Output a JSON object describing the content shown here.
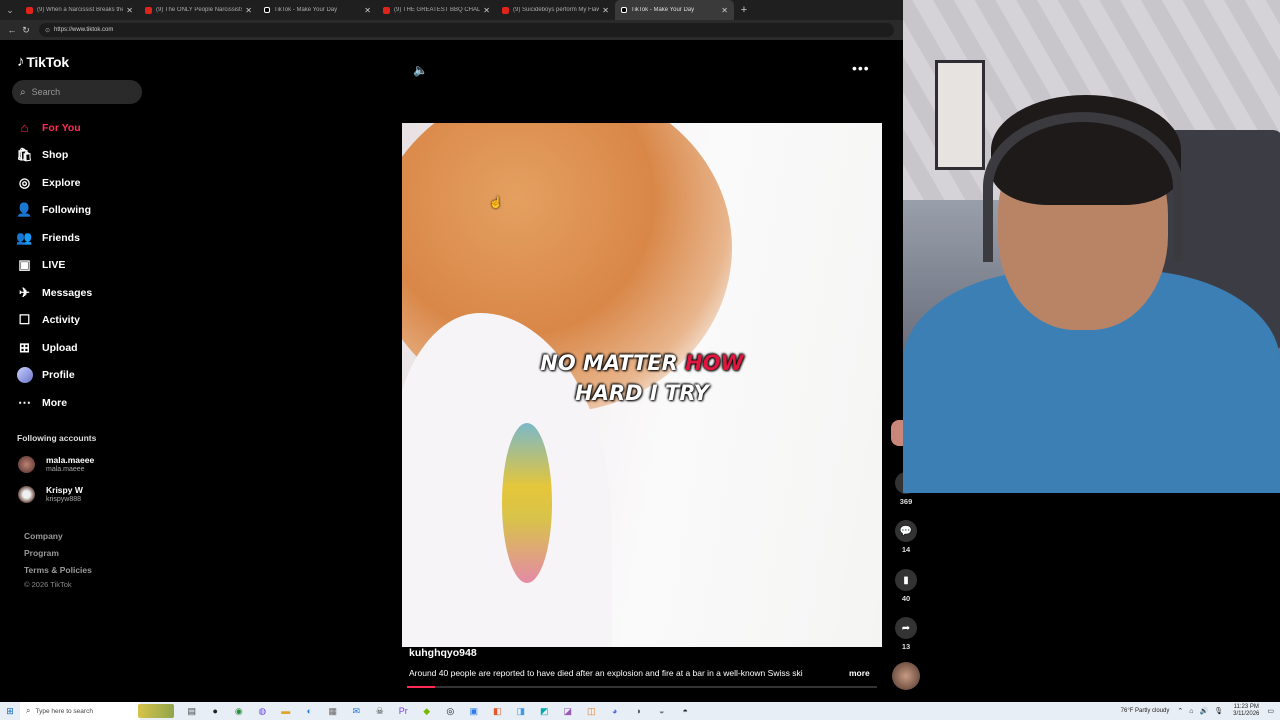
{
  "browser": {
    "tabs": [
      {
        "title": "(9) When a Narcissist Breaks the L",
        "type": "yt",
        "active": false
      },
      {
        "title": "(9) The ONLY People Narcissists H",
        "type": "yt",
        "active": false
      },
      {
        "title": "TikTok - Make Your Day",
        "type": "tt",
        "active": false
      },
      {
        "title": "(9) THE GREATEST BBQ CHALLENG",
        "type": "yt",
        "active": false
      },
      {
        "title": "(9) Suicideboys perform My Flaw",
        "type": "yt",
        "active": false
      },
      {
        "title": "TikTok - Make Your Day",
        "type": "tt",
        "active": true
      }
    ],
    "url": "https://www.tiktok.com"
  },
  "tiktok": {
    "logo": "TikTok",
    "search_placeholder": "Search",
    "nav": [
      {
        "label": "For You",
        "icon": "home-icon",
        "glyph": "⌂",
        "active": true
      },
      {
        "label": "Shop",
        "icon": "shopping-bag-icon",
        "glyph": "🛍",
        "active": false
      },
      {
        "label": "Explore",
        "icon": "compass-icon",
        "glyph": "◎",
        "active": false
      },
      {
        "label": "Following",
        "icon": "person-follow-icon",
        "glyph": "👤",
        "active": false
      },
      {
        "label": "Friends",
        "icon": "friends-icon",
        "glyph": "👥",
        "active": false
      },
      {
        "label": "LIVE",
        "icon": "live-icon",
        "glyph": "▣",
        "active": false
      },
      {
        "label": "Messages",
        "icon": "paper-plane-icon",
        "glyph": "✈",
        "active": false
      },
      {
        "label": "Activity",
        "icon": "activity-icon",
        "glyph": "☐",
        "active": false
      },
      {
        "label": "Upload",
        "icon": "upload-plus-icon",
        "glyph": "⊞",
        "active": false
      },
      {
        "label": "Profile",
        "icon": "profile-avatar-icon",
        "glyph": "",
        "active": false
      },
      {
        "label": "More",
        "icon": "more-dots-icon",
        "glyph": "⋯",
        "active": false
      }
    ],
    "following_header": "Following accounts",
    "following": [
      {
        "name": "mala.maeee",
        "handle": "mala.maeee"
      },
      {
        "name": "Krispy W",
        "handle": "krispyw888"
      }
    ],
    "footer": [
      "Company",
      "Program",
      "Terms & Policies"
    ],
    "copyright": "© 2026 TikTok",
    "video": {
      "caption_line1_a": "NO MATTER ",
      "caption_line1_b": "HOW",
      "caption_line2": "HARD I TRY",
      "author": "kuhghqyo948",
      "description": "Around 40 people are reported to have died after an explosion and fire at a bar in a well-known Swiss ski",
      "more": "more",
      "progress": 0.06
    },
    "actions": {
      "likes": "369",
      "comments": "14",
      "saves": "40",
      "shares": "13"
    },
    "accent": "#fe2c55"
  },
  "taskbar": {
    "search_placeholder": "Type here to search",
    "apps": [
      "file-explorer-icon",
      "obs-icon",
      "chrome-icon",
      "app-icon",
      "folder-icon",
      "edge-icon",
      "calculator-icon",
      "mail-icon",
      "alienware-icon",
      "premiere-icon",
      "nvidia-icon",
      "github-icon",
      "app-icon-2",
      "app-icon-3",
      "app-icon-4",
      "app-icon-5",
      "app-icon-6",
      "app-icon-7",
      "discord-icon",
      "app-icon-8",
      "app-icon-9",
      "steam-icon"
    ],
    "weather": "76°F  Partly cloudy",
    "time": "11:23 PM",
    "date": "3/11/2026"
  }
}
